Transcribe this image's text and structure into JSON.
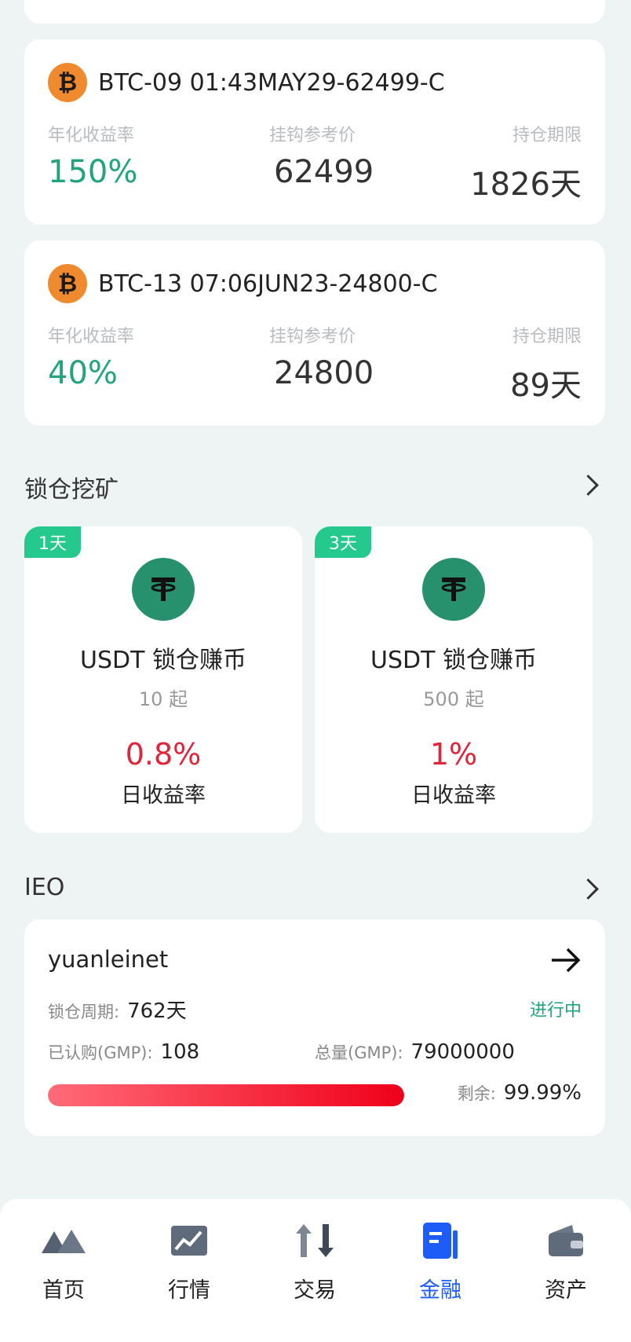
{
  "colors": {
    "accent": "#1d5cf6",
    "green": "#22a57b",
    "red": "#e0253a",
    "badge": "#25c98e",
    "btc": "#f08a2e",
    "usdt": "#26916c"
  },
  "options": [
    {
      "icon": "bitcoin-icon",
      "title": "BTC-09 01:43MAY29-62499-C",
      "yield_label": "年化收益率",
      "yield": "150%",
      "ref_label": "挂钩参考价",
      "ref": "62499",
      "term_label": "持仓期限",
      "term": "1826天"
    },
    {
      "icon": "bitcoin-icon",
      "title": "BTC-13 07:06JUN23-24800-C",
      "yield_label": "年化收益率",
      "yield": "40%",
      "ref_label": "挂钩参考价",
      "ref": "24800",
      "term_label": "持仓期限",
      "term": "89天"
    }
  ],
  "mining": {
    "title": "锁仓挖矿",
    "items": [
      {
        "badge": "1天",
        "name": "USDT 锁仓赚币",
        "min": "10 起",
        "rate": "0.8%",
        "rate_label": "日收益率",
        "icon": "usdt-icon"
      },
      {
        "badge": "3天",
        "name": "USDT 锁仓赚币",
        "min": "500 起",
        "rate": "1%",
        "rate_label": "日收益率",
        "icon": "usdt-icon"
      }
    ]
  },
  "ieo": {
    "title": "IEO",
    "project": "yuanleinet",
    "lock_label": "锁仓周期:",
    "lock_value": "762天",
    "status": "进行中",
    "subscribed_label": "已认购(GMP):",
    "subscribed_value": "108",
    "total_label": "总量(GMP):",
    "total_value": "79000000",
    "remain_label": "剩余:",
    "remain_value": "99.99%",
    "progress_fill_fraction": 1.0
  },
  "nav": [
    {
      "label": "首页",
      "icon": "home-mountain-icon",
      "active": false
    },
    {
      "label": "行情",
      "icon": "market-chart-icon",
      "active": false
    },
    {
      "label": "交易",
      "icon": "trade-arrows-icon",
      "active": false
    },
    {
      "label": "金融",
      "icon": "finance-book-icon",
      "active": true
    },
    {
      "label": "资产",
      "icon": "wallet-icon",
      "active": false
    }
  ]
}
